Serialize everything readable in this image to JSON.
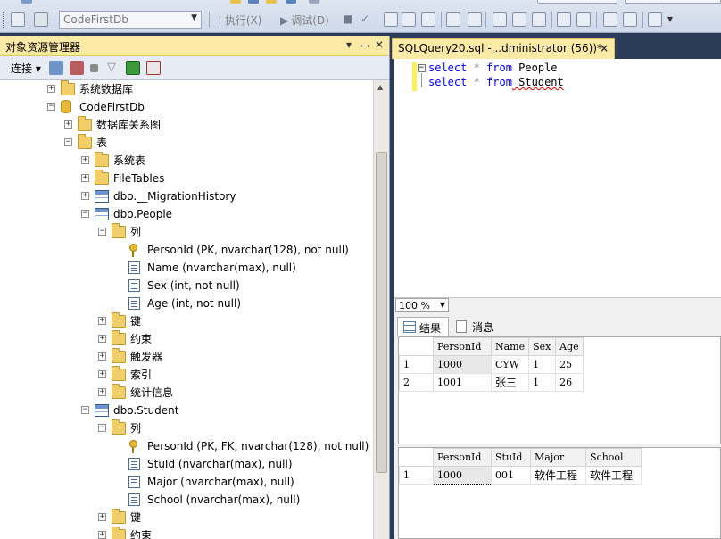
{
  "toolbar": {
    "database": "CodeFirstDb",
    "execute_label": "执行(X)",
    "debug_label": "调试(D)"
  },
  "object_explorer": {
    "title": "对象资源管理器",
    "connect_label": "连接",
    "tree": [
      {
        "label": "系统数据库",
        "kind": "folder",
        "level": 2,
        "expanded": false
      },
      {
        "label": "CodeFirstDb",
        "kind": "database",
        "level": 2,
        "expanded": true
      },
      {
        "label": "数据库关系图",
        "kind": "folder",
        "level": 3,
        "expanded": false
      },
      {
        "label": "表",
        "kind": "folder",
        "level": 3,
        "expanded": true
      },
      {
        "label": "系统表",
        "kind": "folder",
        "level": 4,
        "expanded": false
      },
      {
        "label": "FileTables",
        "kind": "folder",
        "level": 4,
        "expanded": false
      },
      {
        "label": "dbo.__MigrationHistory",
        "kind": "table",
        "level": 4,
        "expanded": false
      },
      {
        "label": "dbo.People",
        "kind": "table",
        "level": 4,
        "expanded": true
      },
      {
        "label": "列",
        "kind": "folder",
        "level": 5,
        "expanded": true
      },
      {
        "label": "PersonId (PK, nvarchar(128), not null)",
        "kind": "key",
        "level": 6
      },
      {
        "label": "Name (nvarchar(max), null)",
        "kind": "column",
        "level": 6
      },
      {
        "label": "Sex (int, not null)",
        "kind": "column",
        "level": 6
      },
      {
        "label": "Age (int, not null)",
        "kind": "column",
        "level": 6
      },
      {
        "label": "键",
        "kind": "folder",
        "level": 5,
        "expanded": false
      },
      {
        "label": "约束",
        "kind": "folder",
        "level": 5,
        "expanded": false
      },
      {
        "label": "触发器",
        "kind": "folder",
        "level": 5,
        "expanded": false
      },
      {
        "label": "索引",
        "kind": "folder",
        "level": 5,
        "expanded": false
      },
      {
        "label": "统计信息",
        "kind": "folder",
        "level": 5,
        "expanded": false
      },
      {
        "label": "dbo.Student",
        "kind": "table",
        "level": 4,
        "expanded": true
      },
      {
        "label": "列",
        "kind": "folder",
        "level": 5,
        "expanded": true
      },
      {
        "label": "PersonId (PK, FK, nvarchar(128), not null)",
        "kind": "key",
        "level": 6
      },
      {
        "label": "StuId (nvarchar(max), null)",
        "kind": "column",
        "level": 6
      },
      {
        "label": "Major (nvarchar(max), null)",
        "kind": "column",
        "level": 6
      },
      {
        "label": "School (nvarchar(max), null)",
        "kind": "column",
        "level": 6
      },
      {
        "label": "键",
        "kind": "folder",
        "level": 5,
        "expanded": false
      },
      {
        "label": "约束",
        "kind": "folder",
        "level": 5,
        "expanded": false
      }
    ]
  },
  "query_tab": {
    "title": "SQLQuery20.sql -...dministrator (56))*",
    "close": "×"
  },
  "editor": {
    "lines": [
      {
        "kw1": "select",
        "op": " * ",
        "kw2": "from",
        "table": " People"
      },
      {
        "kw1": "select",
        "op": " * ",
        "kw2": "from",
        "table": " Student"
      }
    ]
  },
  "zoom": "100 %",
  "results_tabs": {
    "results": "结果",
    "messages": "消息"
  },
  "grid1": {
    "columns": [
      "PersonId",
      "Name",
      "Sex",
      "Age"
    ],
    "rows": [
      [
        "1",
        "1000",
        "CYW",
        "1",
        "25"
      ],
      [
        "2",
        "1001",
        "张三",
        "1",
        "26"
      ]
    ]
  },
  "grid2": {
    "columns": [
      "PersonId",
      "StuId",
      "Major",
      "School"
    ],
    "rows": [
      [
        "1",
        "1000",
        "001",
        "软件工程",
        "软件工程"
      ]
    ]
  }
}
